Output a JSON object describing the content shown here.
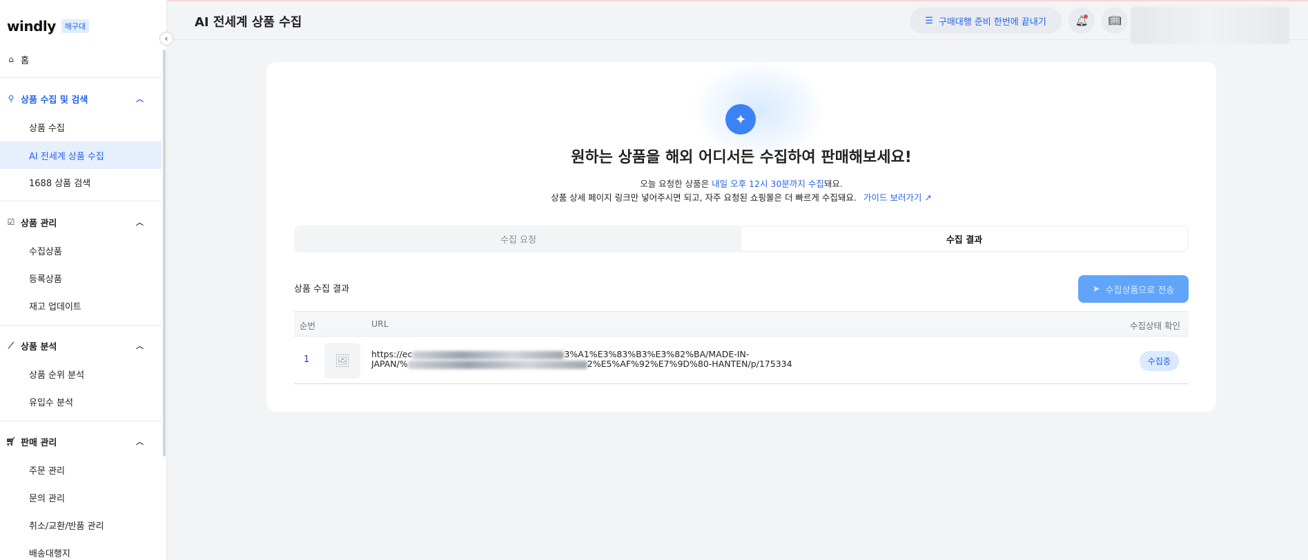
{
  "brand": {
    "logo": "windly",
    "badge": "해구대"
  },
  "sidebar": {
    "home": "홈",
    "sections": [
      {
        "label": "상품 수집 및 검색",
        "items": [
          "상품 수집",
          "AI 전세계 상품 수집",
          "1688 상품 검색"
        ]
      },
      {
        "label": "상품 관리",
        "items": [
          "수집상품",
          "등록상품",
          "재고 업데이트"
        ]
      },
      {
        "label": "상품 분석",
        "items": [
          "상품 순위 분석",
          "유입수 분석"
        ]
      },
      {
        "label": "판매 관리",
        "items": [
          "주문 관리",
          "문의 관리",
          "취소/교환/반품 관리",
          "배송대행지"
        ]
      }
    ],
    "active_item": "AI 전세계 상품 수집"
  },
  "header": {
    "title": "AI 전세계 상품 수집",
    "guide_button": "구매대행 준비 한번에 끝내기"
  },
  "hero": {
    "title": "원하는 상품을 해외 어디서든 수집하여 판매해보세요!",
    "line1_pre": "오늘 요청한 상품은 ",
    "line1_blue": "내일 오후 12시 30분까지 수집",
    "line1_post": "돼요.",
    "line2": "상품 상세 페이지 링크만 넣어주시면 되고, 자주 요청된 쇼핑몰은 더 빠르게 수집돼요.",
    "guide_link": "가이드 보러가기"
  },
  "tabs": [
    "수집 요청",
    "수집 결과"
  ],
  "active_tab": "수집 결과",
  "results": {
    "label": "상품 수집 결과",
    "send_button": "수집상품으로 전송",
    "columns": [
      "순번",
      "URL",
      "수집상태 확인"
    ],
    "rows": [
      {
        "index": "1",
        "url_line1_start": "https://ec",
        "url_line1_end": "3%A1%E3%83%B3%E3%82%BA/MADE-IN-",
        "url_line2_start": "JAPAN/%",
        "url_line2_end": "2%E5%AF%92%E7%9D%80-HANTEN/p/175334",
        "status": "수집중"
      }
    ]
  },
  "colors": {
    "accent": "#2563eb",
    "active_bg": "#e6effc",
    "send_button": "#60a5fa"
  },
  "icons": [
    "home-icon",
    "search-icon",
    "checkbox-icon",
    "chart-icon",
    "cart-icon",
    "chevron-up-icon",
    "chevron-left-icon",
    "list-icon",
    "bell-icon",
    "book-icon",
    "sparkle-icon",
    "external-link-icon",
    "send-icon",
    "image-placeholder-icon"
  ]
}
